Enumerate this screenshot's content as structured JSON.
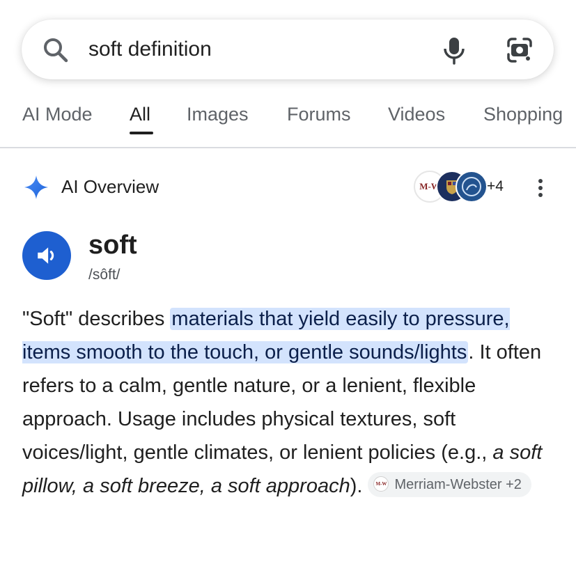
{
  "search": {
    "query": "soft definition"
  },
  "tabs": [
    {
      "label": "AI Mode"
    },
    {
      "label": "All"
    },
    {
      "label": "Images"
    },
    {
      "label": "Forums"
    },
    {
      "label": "Videos"
    },
    {
      "label": "Shopping"
    }
  ],
  "active_tab": "All",
  "ai_overview": {
    "title": "AI Overview",
    "sources": {
      "logos": [
        "M-W",
        "university-crest",
        "encyclopedia-logo"
      ],
      "more_count": "+4"
    },
    "word": "soft",
    "phonetic": "/sôft/",
    "definition": {
      "intro": "\"Soft\" describes ",
      "highlight": "materials that yield easily to pressure, items smooth to the touch, or gentle sounds/lights",
      "body": ". It often refers to a calm, gentle nature, or a lenient, flexible approach. Usage includes physical textures, soft voices/light, gentle climates, or lenient policies (e.g., ",
      "examples": "a soft pillow, a soft breeze, a soft approach",
      "end": ")."
    },
    "citation": {
      "logo": "M-W",
      "label": "Merriam-Webster +2"
    }
  },
  "colors": {
    "accent_blue": "#1e5fd0",
    "highlight": "#d3e3fd",
    "text": "#1f1f1f",
    "muted": "#5f6368"
  },
  "icons": [
    "search-icon",
    "mic-icon",
    "lens-icon",
    "ai-sparkle-icon",
    "more-vert-icon",
    "speaker-icon"
  ]
}
